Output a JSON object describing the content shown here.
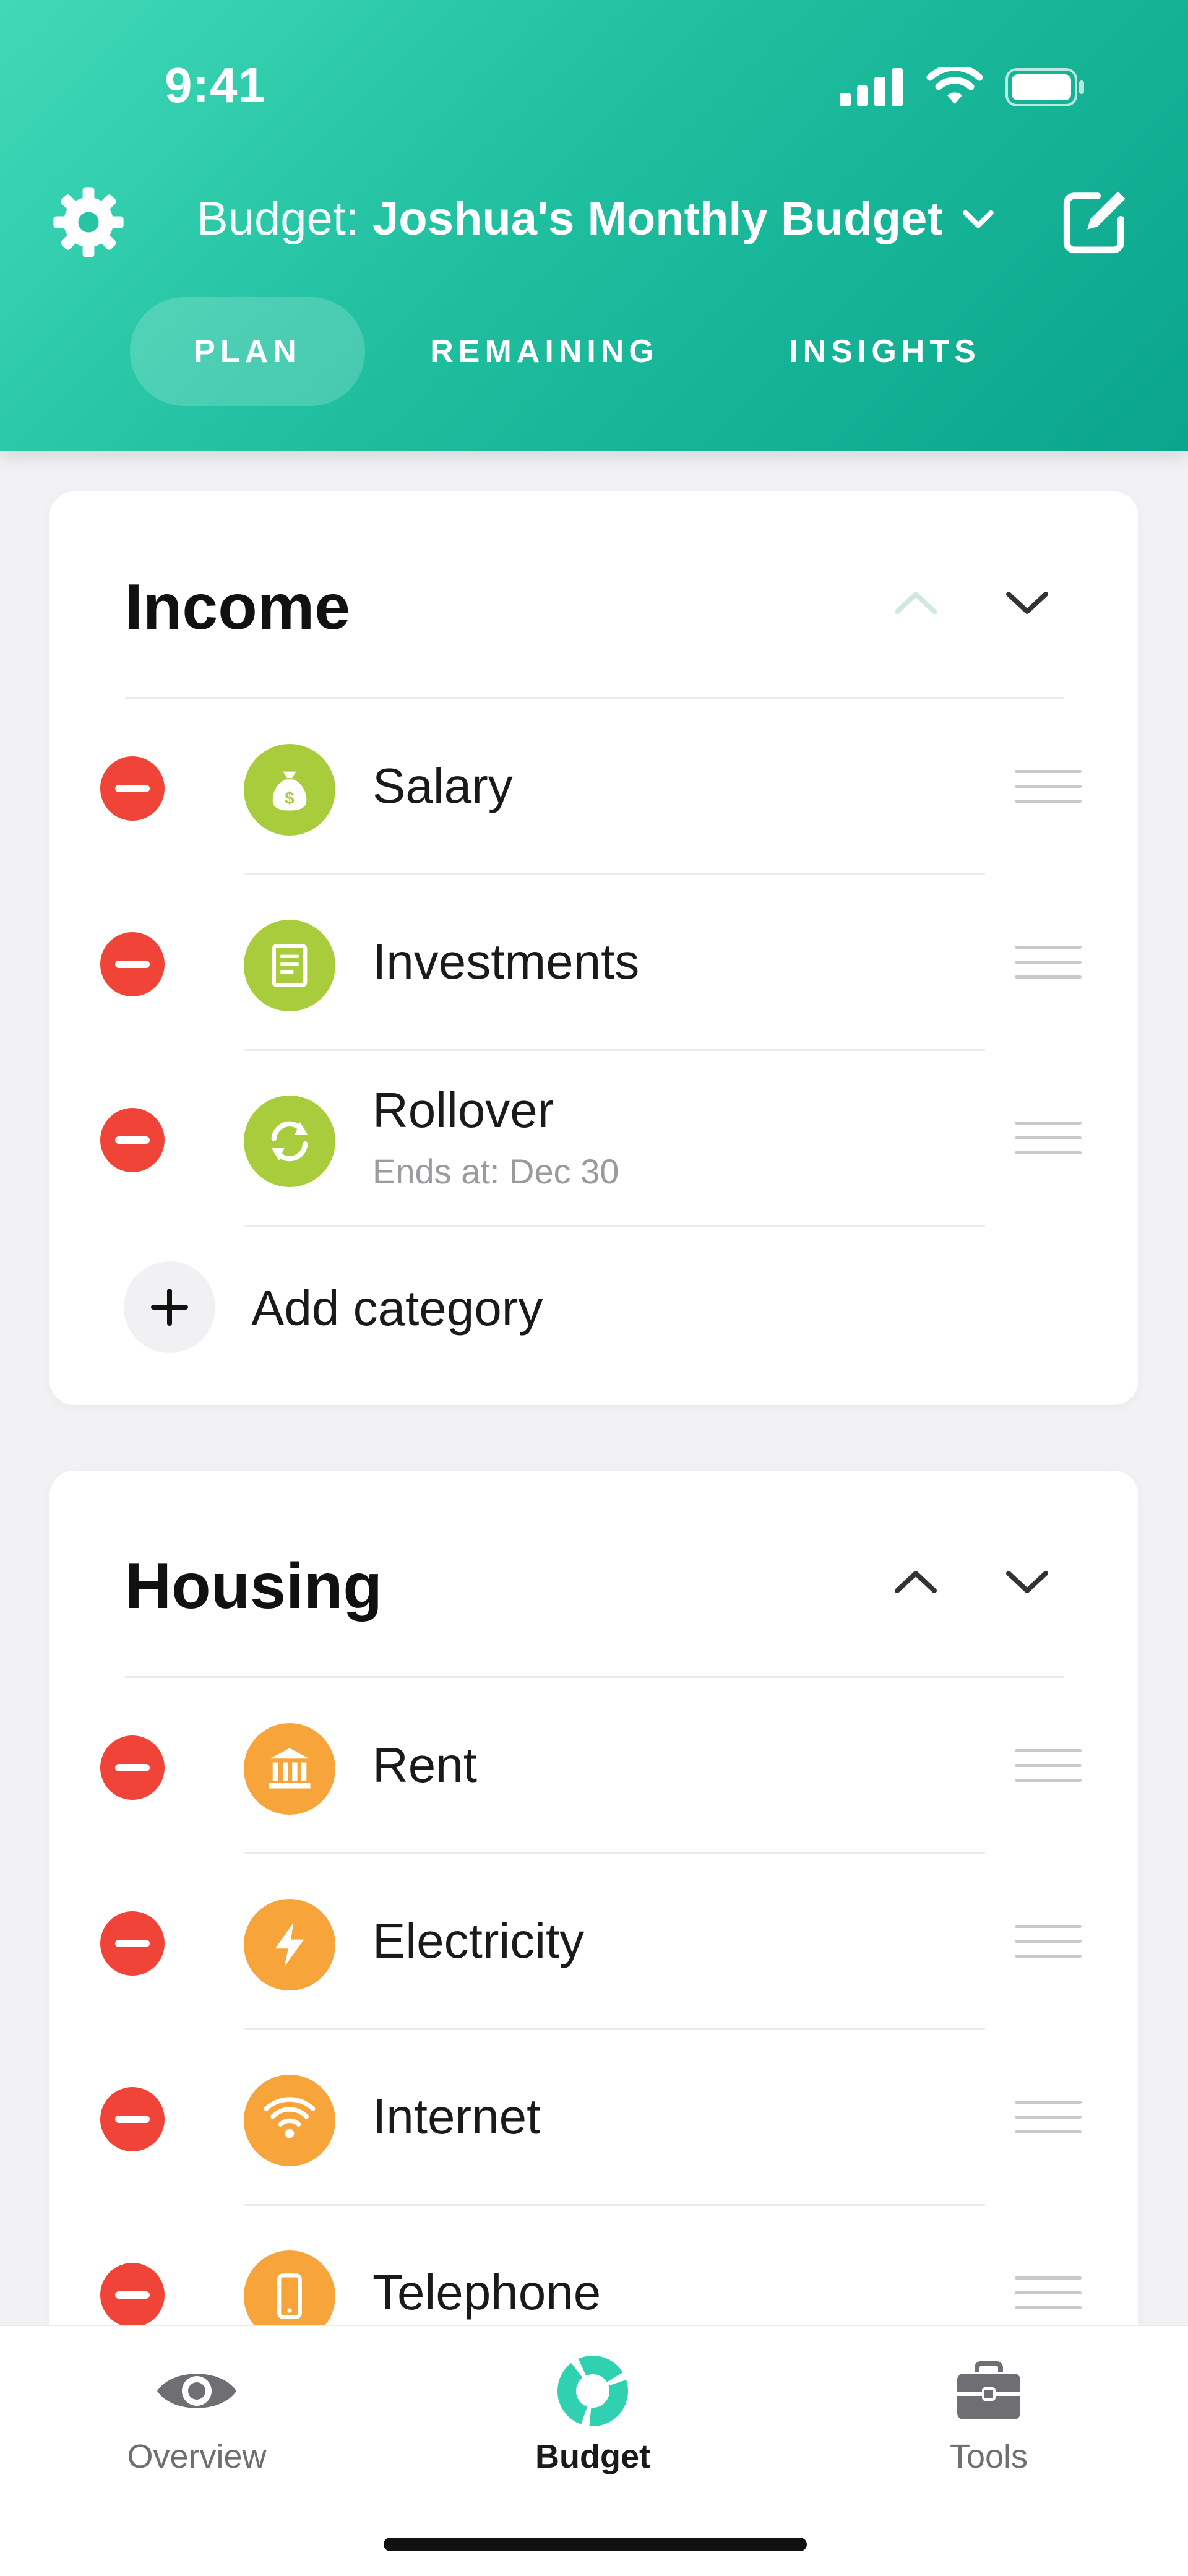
{
  "status_bar": {
    "time": "9:41"
  },
  "header": {
    "budget_prefix": "Budget:",
    "budget_name": "Joshua's Monthly Budget",
    "tabs": [
      {
        "label": "PLAN",
        "active": true
      },
      {
        "label": "REMAINING",
        "active": false
      },
      {
        "label": "INSIGHTS",
        "active": false
      }
    ]
  },
  "income": {
    "title": "Income",
    "items": [
      {
        "label": "Salary",
        "icon": "money-bag-icon"
      },
      {
        "label": "Investments",
        "icon": "document-icon"
      },
      {
        "label": "Rollover",
        "sub": "Ends at: Dec 30",
        "icon": "refresh-icon"
      }
    ],
    "add_label": "Add category"
  },
  "housing": {
    "title": "Housing",
    "items": [
      {
        "label": "Rent",
        "icon": "bank-icon"
      },
      {
        "label": "Electricity",
        "icon": "lightning-icon"
      },
      {
        "label": "Internet",
        "icon": "wifi-icon"
      },
      {
        "label": "Telephone",
        "icon": "phone-icon"
      }
    ]
  },
  "tab_bar": {
    "items": [
      {
        "label": "Overview",
        "icon": "eye-icon",
        "active": false
      },
      {
        "label": "Budget",
        "icon": "budget-donut-icon",
        "active": true
      },
      {
        "label": "Tools",
        "icon": "toolbox-icon",
        "active": false
      }
    ]
  },
  "colors": {
    "accent": "#1fbf9f",
    "remove": "#f04438",
    "income_icon": "#a9cc3c",
    "housing_icon": "#f7a53a"
  }
}
